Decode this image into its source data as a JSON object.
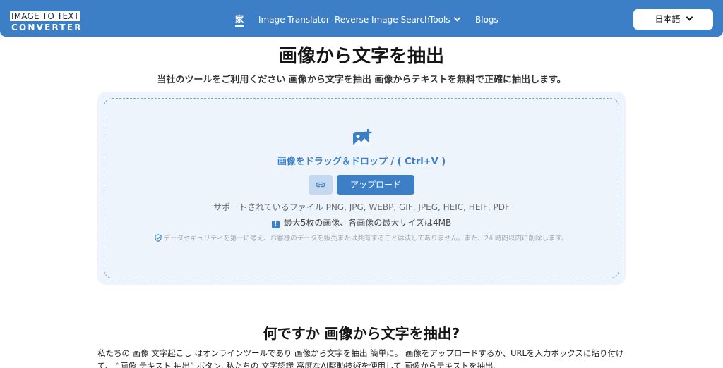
{
  "header": {
    "logo_top": "IMAGE TO TEXT",
    "logo_bottom": "CONVERTER",
    "nav": [
      {
        "label": "家",
        "active": true
      },
      {
        "label": "Image Translator"
      },
      {
        "label": "Reverse Image Search"
      },
      {
        "label": "Tools",
        "has_dropdown": true
      },
      {
        "label": "Blogs"
      }
    ],
    "language": "日本語"
  },
  "hero": {
    "title": "画像から文字を抽出",
    "subtitle": "当社のツールをご利用ください 画像から文字を抽出 画像からテキストを無料で正確に抽出します。"
  },
  "upload": {
    "drag_text": "画像をドラッグ＆ドロップ / ( Ctrl+V )",
    "upload_button": "アップロード",
    "formats": "サポートされているファイル PNG, JPG, WEBP, GIF, JPEG, HEIC, HEIF, PDF",
    "max_files": "最大5枚の画像、各画像の最大サイズは4MB",
    "security": "データセキュリティを第一に考え、お客様のデータを販売または共有することは決してありません。また、24 時間以内に削除します。"
  },
  "about": {
    "title": "何ですか 画像から文字を抽出?",
    "paragraph": "私たちの 画像 文字起こし はオンラインツールであり 画像から文字を抽出 簡単に。 画像をアップロードするか、URLを入力ボックスに貼り付けて、 “画像 テキスト 抽出” ボタン. 私たちの 文字認識 高度なAI駆動技術を使用して 画像からテキストを抽出."
  },
  "colors": {
    "brand": "#3d7fc6",
    "upload_bg": "#edf4fb"
  }
}
